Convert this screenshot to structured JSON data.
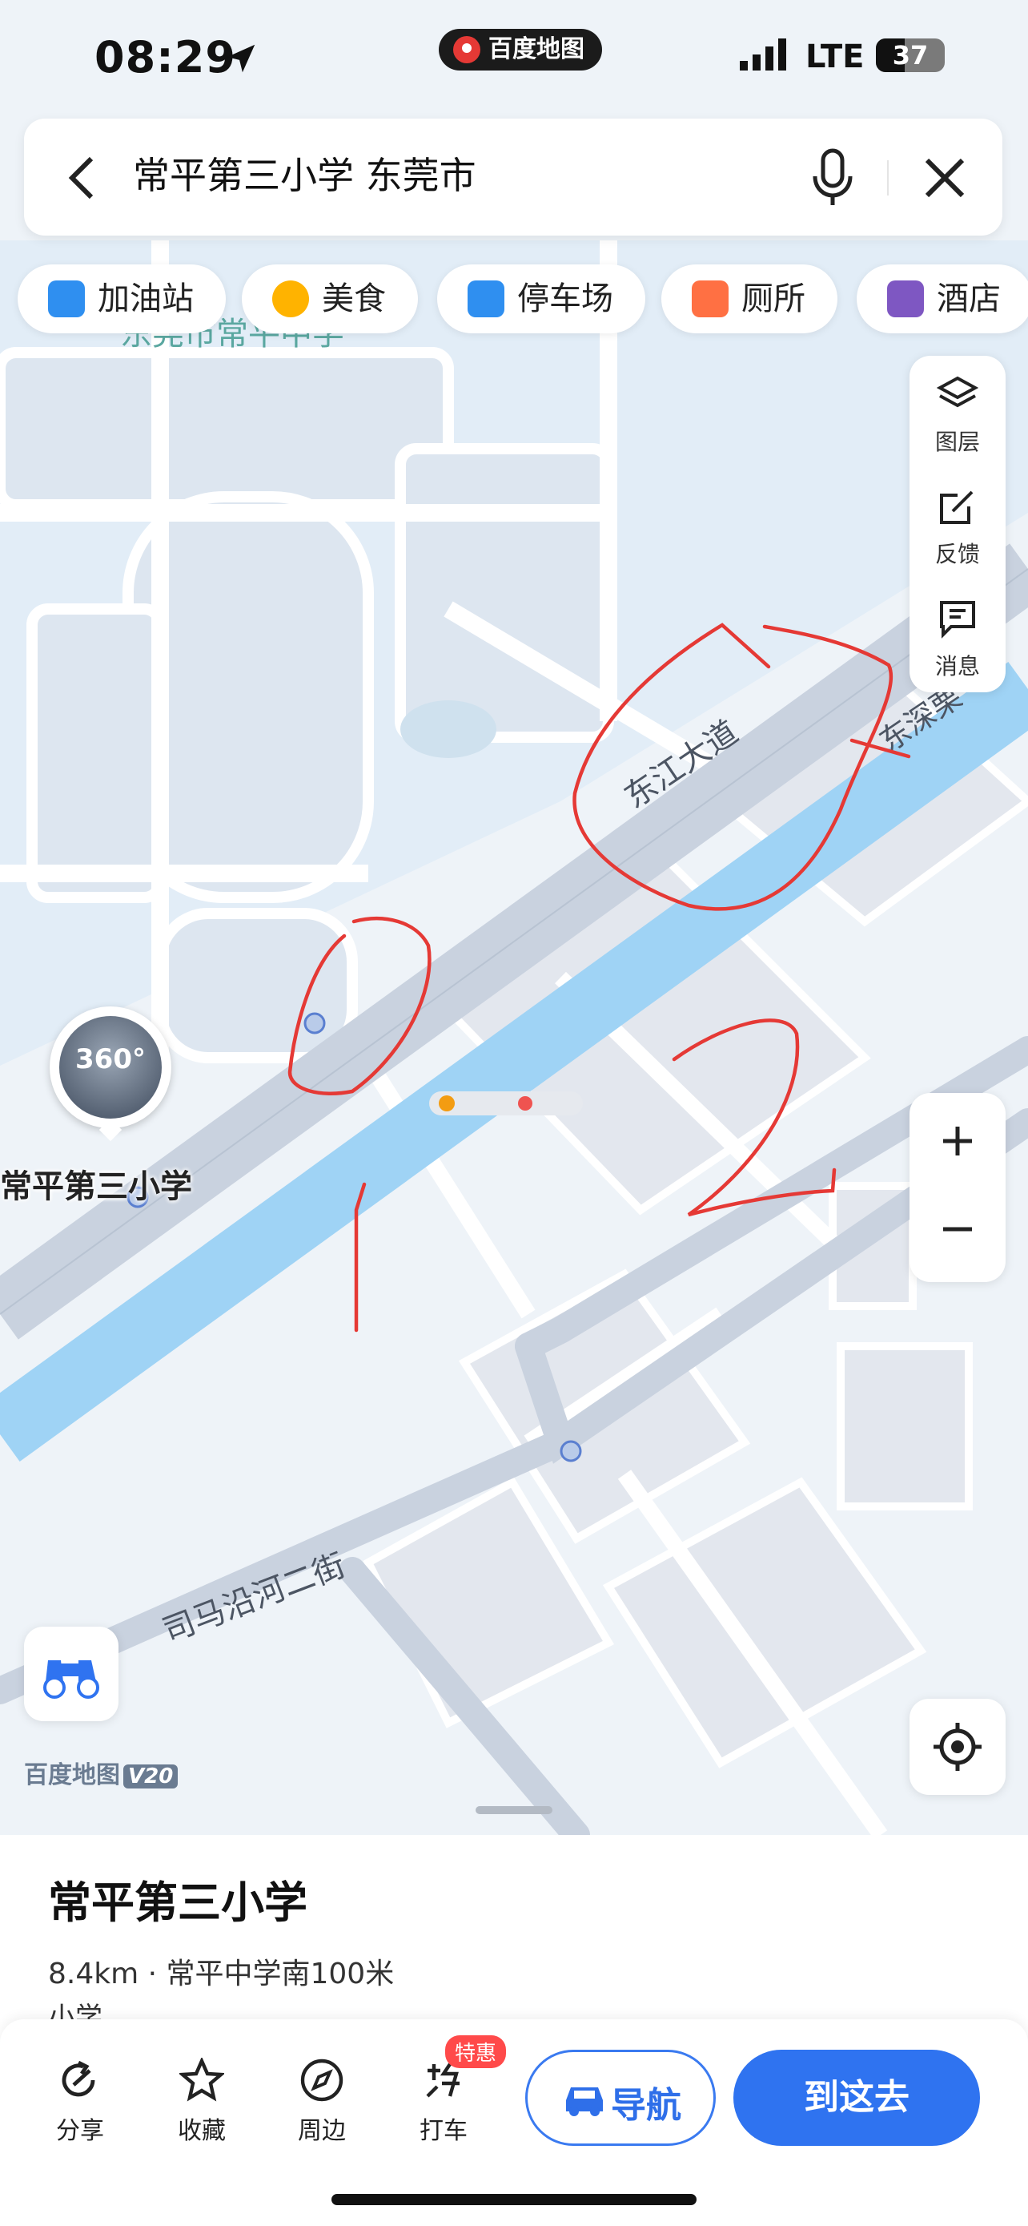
{
  "status_bar": {
    "time": "08:29",
    "app_badge": "百度地图",
    "network": "LTE",
    "battery": "37"
  },
  "search": {
    "query": "常平第三小学 东莞市"
  },
  "chips": [
    {
      "label": "加油站",
      "color": "#2f8ff0"
    },
    {
      "label": "美食",
      "color": "#ffb300"
    },
    {
      "label": "停车场",
      "color": "#2f8ff0"
    },
    {
      "label": "厕所",
      "color": "#ff7043"
    },
    {
      "label": "酒店",
      "color": "#7e57c2"
    }
  ],
  "side_tools": {
    "layers": "图层",
    "feedback": "反馈",
    "messages": "消息"
  },
  "map": {
    "labels": {
      "school_top": "东莞市常平中学",
      "road_main": "东江大道",
      "road_right": "东深栗",
      "road_bottom": "司马沿河二街"
    },
    "poi": {
      "label": "常平第三小学",
      "panorama": "360°"
    },
    "brand": "百度地图",
    "brand_version": "V20",
    "road_color": "#c9d2df",
    "river_color": "#9fd3f5",
    "annotation_color": "#e53935"
  },
  "place": {
    "title": "常平第三小学",
    "meta": "8.4km · 常平中学南100米",
    "category": "小学"
  },
  "actions": {
    "share": "分享",
    "favorite": "收藏",
    "nearby": "周边",
    "taxi": "打车",
    "taxi_badge": "特惠",
    "navigate": "导航",
    "go_here": "到这去"
  }
}
